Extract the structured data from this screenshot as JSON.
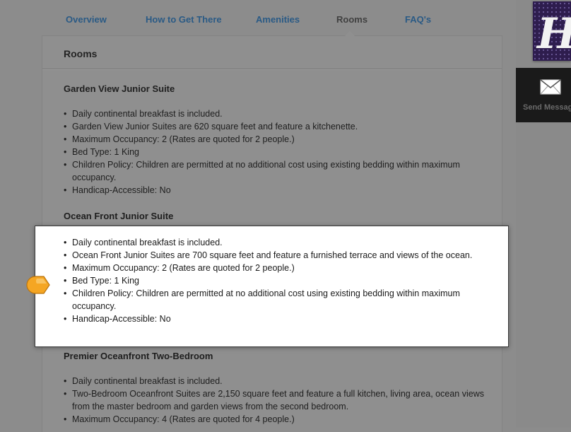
{
  "nav": {
    "tabs": [
      {
        "label": "Overview"
      },
      {
        "label": "How to Get There"
      },
      {
        "label": "Amenities"
      },
      {
        "label": "Rooms",
        "active": true
      },
      {
        "label": "FAQ's"
      }
    ]
  },
  "panel": {
    "title": "Rooms"
  },
  "rooms": [
    {
      "name": "Garden View Junior Suite",
      "bullets": [
        "Daily continental breakfast is included.",
        "Garden View Junior Suites are 620 square feet and feature a kitchenette.",
        "Maximum Occupancy: 2 (Rates are quoted for 2 people.)",
        "Bed Type: 1 King",
        "Children Policy: Children are permitted at no additional cost using existing bedding within maximum occupancy.",
        "Handicap-Accessible: No"
      ]
    },
    {
      "name": "Ocean Front Junior Suite",
      "highlighted": true,
      "bullets": [
        "Daily continental breakfast is included.",
        "Ocean Front Junior Suites are 700 square feet and feature a furnished terrace and views of the ocean.",
        "Maximum Occupancy: 2 (Rates are quoted for 2 people.)",
        "Bed Type: 1 King",
        "Children Policy: Children are permitted at no additional cost using existing bedding within maximum occupancy.",
        "Handicap-Accessible: No"
      ]
    },
    {
      "name": "Premier Oceanfront Two-Bedroom",
      "bullets": [
        "Daily continental breakfast is included.",
        "Two-Bedroom Oceanfront Suites are 2,150 square feet and feature a full kitchen, living area, ocean views from the master bedroom and garden views from the second bedroom.",
        "Maximum Occupancy: 4 (Rates are quoted for 4 people.)"
      ]
    }
  ],
  "sidebar": {
    "send_message_label": "Send Message",
    "message_icon": "envelope-icon",
    "logo_text": "H"
  },
  "colors": {
    "background": "#8c8c8c",
    "tab_link": "#2a5a85",
    "tab_active": "#404040",
    "highlight_bg": "#ffffff",
    "marker": "#f5a623",
    "logo_bg": "#2e1d4e"
  }
}
